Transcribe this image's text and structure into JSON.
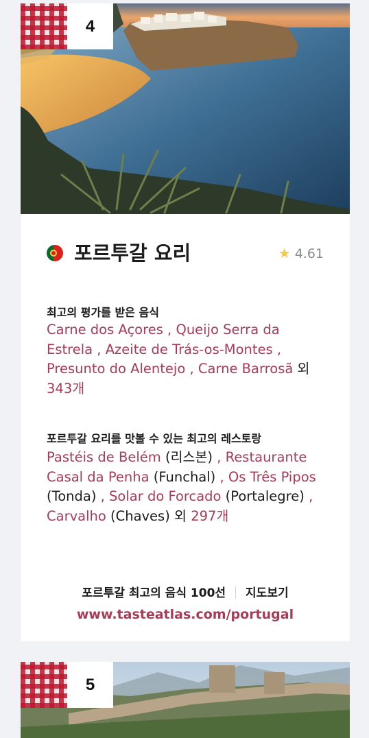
{
  "cards": [
    {
      "rank": "4",
      "title": "포르투갈 요리",
      "rating": "4.61",
      "flag_colors": {
        "green": "#0b6b2c",
        "red": "#d9241c",
        "emblem": "#f6d34a"
      },
      "best_rated_label": "최고의 평가를 받은 음식",
      "best_rated_foods": [
        "Carne dos Açores",
        "Queijo Serra da Estrela",
        "Azeite de Trás-os-Montes",
        "Presunto do Alentejo",
        "Carne Barrosã"
      ],
      "best_rated_suffix": "외",
      "best_rated_more": "343개",
      "restaurants_label": "포르투갈 요리를 맛볼 수 있는 최고의 레스토랑",
      "restaurants": [
        {
          "name": "Pastéis de Belém",
          "place": "(리스본)"
        },
        {
          "name": "Restaurante Casal da Penha",
          "place": "(Funchal)"
        },
        {
          "name": "Os Três Pipos",
          "place": "(Tonda)"
        },
        {
          "name": "Solar do Forcado",
          "place": "(Portalegre)"
        },
        {
          "name": "Carvalho",
          "place": "(Chaves)"
        }
      ],
      "restaurants_suffix": "외",
      "restaurants_more": "297개",
      "top100_link": "포르투갈 최고의 음식 100선",
      "map_link": "지도보기",
      "url": "www.tasteatlas.com/portugal"
    },
    {
      "rank": "5"
    }
  ],
  "accent_color": "#a83b57",
  "icons": {
    "star": "star-icon",
    "flag": "portugal-flag-icon"
  }
}
